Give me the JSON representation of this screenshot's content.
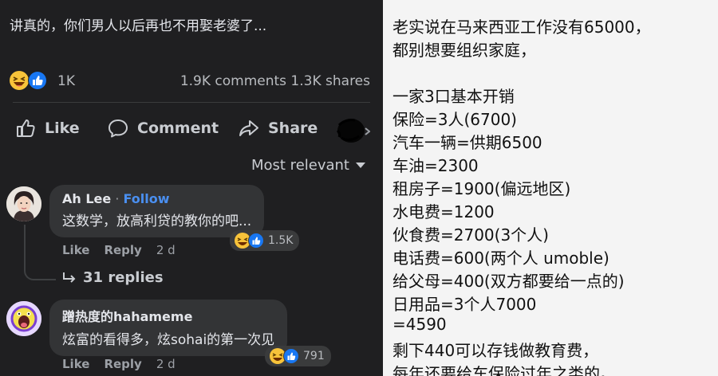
{
  "post": {
    "text": "讲真的，你们男人以后再也不用娶老婆了...",
    "reaction_count": "1K",
    "stats": "1.9K comments  1.3K shares"
  },
  "actions": {
    "like": "Like",
    "comment": "Comment",
    "share": "Share"
  },
  "sort": {
    "label": "Most relevant"
  },
  "comments": [
    {
      "author": "Ah Lee",
      "follow": "Follow",
      "text": "这数学，放高利贷的教你的吧...",
      "reactions": "1.5K",
      "like": "Like",
      "reply": "Reply",
      "time": "2 d",
      "replies": "31 replies"
    },
    {
      "author": "蹭热度的hahameme",
      "text": "炫富的看得多，炫sohai的第一次见",
      "reactions": "791",
      "like": "Like",
      "reply": "Reply",
      "time": "2 d"
    }
  ],
  "note": {
    "lines": [
      "老实说在马来西亚工作没有65000，",
      "都别想要组织家庭，",
      "",
      "一家3口基本开销",
      "保险=3人(6700)",
      "汽车一辆=供期6500",
      "车油=2300",
      "租房子=1900(偏远地区)",
      "水电费=1200",
      "伙食费=2700(3个人)",
      "电话费=600(两个人 umoble)",
      "给父母=400(双方都要给一点的)",
      "日用品=3个人7000",
      "=4590",
      "剩下440可以存钱做教育费，",
      "每年还要给车保险过年之类的。"
    ]
  },
  "colors": {
    "link": "#4a8ff0",
    "like_blue": "#1877f2",
    "haha_yellow": "#f7c33a"
  }
}
